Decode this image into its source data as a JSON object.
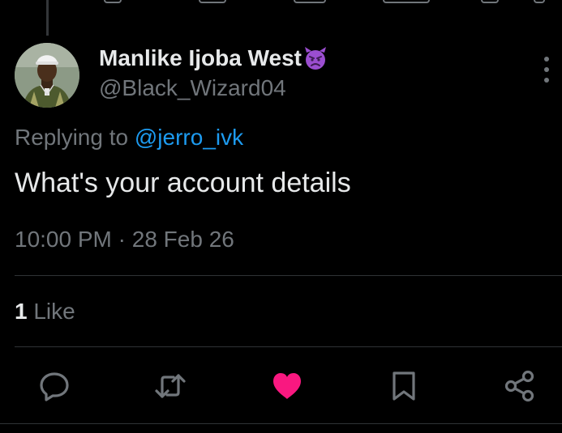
{
  "tweet": {
    "display_name": "Manlike Ijoba West",
    "name_emoji": "angry-devil-emoji",
    "handle": "@Black_Wizard04",
    "replying_prefix": "Replying to",
    "replying_to": "@jerro_ivk",
    "text": "What's your account details",
    "time": "10:00 PM",
    "separator": "·",
    "date": "28 Feb 26"
  },
  "stats": {
    "likes_count": "1",
    "likes_label": "Like"
  },
  "actions": [
    {
      "icon": "reply-icon"
    },
    {
      "icon": "retweet-icon"
    },
    {
      "icon": "liked-heart-icon",
      "active": true
    },
    {
      "icon": "bookmark-icon"
    },
    {
      "icon": "share-icon"
    }
  ],
  "colors": {
    "background": "#000000",
    "primary_text": "#e7e9ea",
    "secondary_text": "#71767b",
    "link": "#1d9bf0",
    "like_active": "#f91880",
    "divider": "#2f3336",
    "emoji_purple": "#9b4ed0"
  }
}
